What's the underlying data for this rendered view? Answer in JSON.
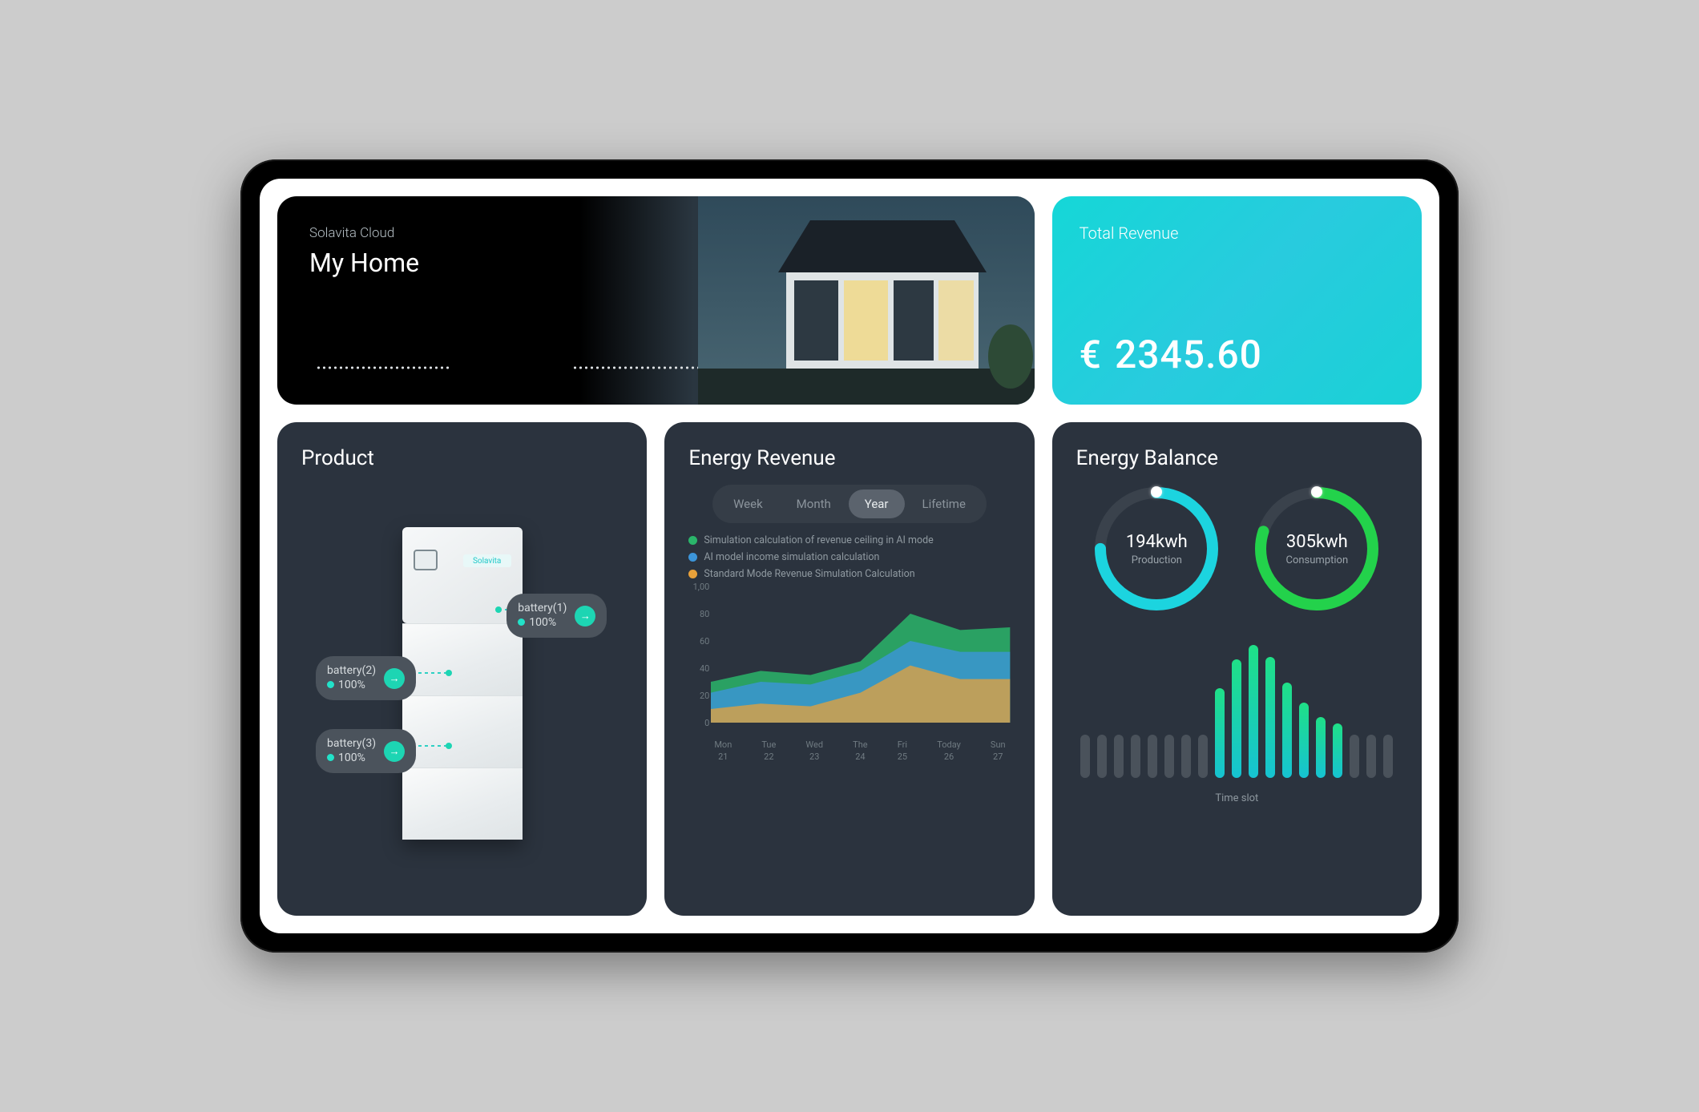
{
  "hero": {
    "subtitle": "Solavita Cloud",
    "title": "My Home"
  },
  "revenue": {
    "label": "Total Revenue",
    "currency": "€",
    "value": "2345.60"
  },
  "product": {
    "title": "Product",
    "brand": "Solavita",
    "batteries": [
      {
        "label": "battery(1)",
        "pct": "100%"
      },
      {
        "label": "battery(2)",
        "pct": "100%"
      },
      {
        "label": "battery(3)",
        "pct": "100%"
      }
    ]
  },
  "energy_revenue": {
    "title": "Energy  Revenue",
    "tabs": [
      "Week",
      "Month",
      "Year",
      "Lifetime"
    ],
    "active_tab": 2,
    "legend": [
      {
        "color": "#2ab56a",
        "label": "Simulation calculation of revenue ceiling in AI mode"
      },
      {
        "color": "#3c95d9",
        "label": "AI model income simulation calculation"
      },
      {
        "color": "#e8a13a",
        "label": "Standard Mode Revenue Simulation Calculation"
      }
    ],
    "chart_data": {
      "type": "area",
      "x": [
        {
          "d": "Mon",
          "n": "21"
        },
        {
          "d": "Tue",
          "n": "22"
        },
        {
          "d": "Wed",
          "n": "23"
        },
        {
          "d": "The",
          "n": "24"
        },
        {
          "d": "Fri",
          "n": "25"
        },
        {
          "d": "Today",
          "n": "26"
        },
        {
          "d": "Sun",
          "n": "27"
        }
      ],
      "yticks": [
        0,
        20,
        40,
        60,
        80,
        100
      ],
      "ylim": [
        0,
        100
      ],
      "series": [
        {
          "name": "ceiling",
          "color": "#2ab56a",
          "values": [
            30,
            38,
            35,
            45,
            80,
            68,
            70
          ]
        },
        {
          "name": "ai",
          "color": "#3c95d9",
          "values": [
            22,
            30,
            28,
            38,
            60,
            52,
            52
          ]
        },
        {
          "name": "standard",
          "color": "#e8a13a",
          "values": [
            10,
            14,
            12,
            22,
            42,
            32,
            32
          ]
        }
      ]
    }
  },
  "energy_balance": {
    "title": "Energy Balance",
    "axis": "Time slot",
    "gauges": [
      {
        "name": "production",
        "value": "194kwh",
        "label": "Production",
        "pct": 0.75,
        "color": "#1cd4df"
      },
      {
        "name": "consumption",
        "value": "305kwh",
        "label": "Consumption",
        "pct": 0.8,
        "color": "#23d24b"
      }
    ],
    "chart_data": {
      "type": "bar",
      "max": 100,
      "bars": [
        30,
        30,
        30,
        30,
        30,
        30,
        30,
        30,
        62,
        82,
        92,
        84,
        66,
        52,
        42,
        38,
        30,
        30,
        30
      ],
      "active": [
        false,
        false,
        false,
        false,
        false,
        false,
        false,
        false,
        true,
        true,
        true,
        true,
        true,
        true,
        true,
        true,
        false,
        false,
        false
      ]
    }
  }
}
